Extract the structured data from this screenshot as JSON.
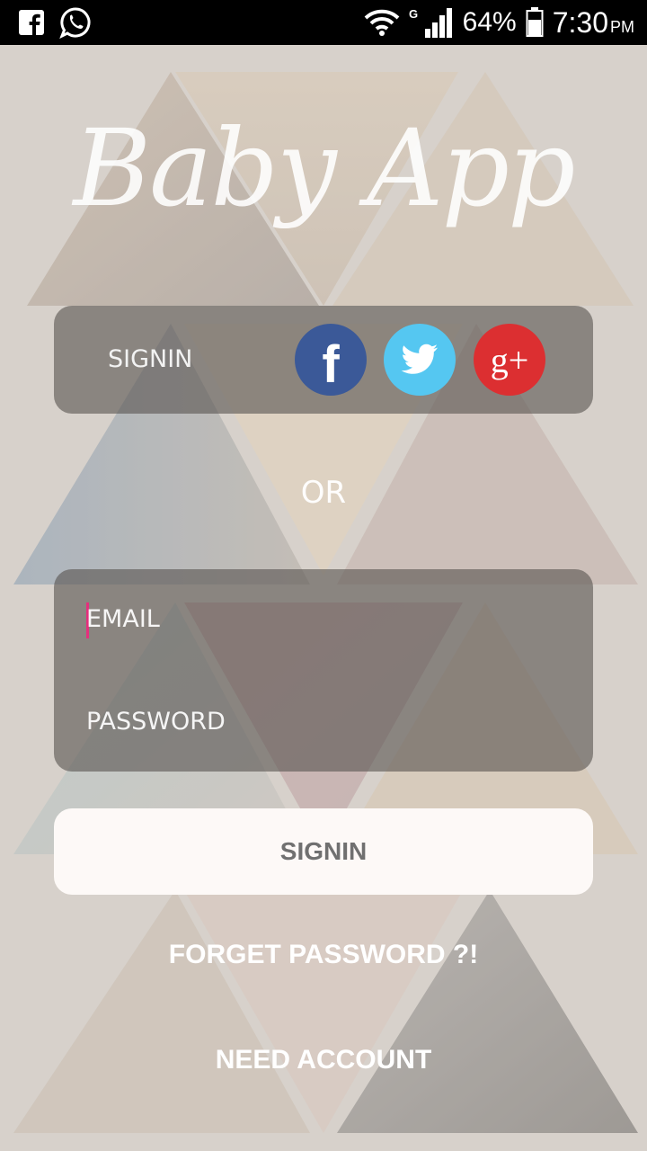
{
  "status_bar": {
    "left_icons": [
      "facebook-icon",
      "whatsapp-icon"
    ],
    "network_type": "G",
    "battery_percent": "64%",
    "time": "7:30",
    "ampm": "PM"
  },
  "app": {
    "title": "Baby App"
  },
  "social": {
    "label": "SIGNIN",
    "providers": [
      "facebook",
      "twitter",
      "google-plus"
    ],
    "google_plus_glyph": "g+",
    "facebook_glyph": "f"
  },
  "divider": {
    "text": "OR"
  },
  "form": {
    "email_placeholder": "EMAIL",
    "password_placeholder": "PASSWORD",
    "submit_label": "SIGNIN"
  },
  "links": {
    "forget_password": "FORGET PASSWORD ?!",
    "need_account": "NEED ACCOUNT"
  },
  "colors": {
    "facebook": "#3b5998",
    "twitter": "#55c7f1",
    "google_plus": "#dc2f31",
    "caret": "#e4307d"
  }
}
